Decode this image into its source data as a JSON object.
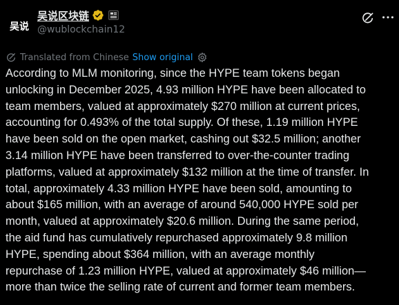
{
  "header": {
    "avatar_text": "吴说",
    "display_name": "吴说区块链",
    "handle": "@wublockchain12"
  },
  "translation": {
    "label": "Translated from Chinese",
    "show_original": "Show original"
  },
  "tweet": {
    "lines": [
      "According to MLM monitoring, since the HYPE team tokens began",
      "unlocking in December 2025, 4.93 million HYPE have been allocated to",
      "team members, valued at approximately $270 million at current prices,",
      "accounting for 0.493% of the total supply. Of these, 1.19 million HYPE",
      "have been sold on the open market, cashing out $32.5 million; another",
      "3.14 million HYPE have been transferred to over-the-counter trading",
      "platforms, valued at approximately $132 million at the time of transfer. In",
      "total, approximately 4.33 million HYPE have been sold, amounting to",
      "about $165 million, with an average of around 540,000 HYPE sold per",
      "month, valued at approximately $20.6 million. During the same period,",
      "the aid fund has cumulatively repurchased approximately 9.8 million",
      "HYPE, spending about $364 million, with an average monthly",
      "repurchase of 1.23 million HYPE, valued at approximately $46 million—",
      "more than twice the selling rate of current and former team members."
    ]
  },
  "icons": {
    "verified": "verified-badge-icon",
    "affiliate": "affiliate-badge-icon",
    "grok": "grok-icon",
    "more": "more-icon",
    "translate": "translate-globe-icon",
    "settings": "gear-icon"
  },
  "colors": {
    "background": "#000000",
    "text": "#e7e9ea",
    "muted": "#71767b",
    "link": "#1d9bf0",
    "verified_gold": "#e2b719"
  }
}
